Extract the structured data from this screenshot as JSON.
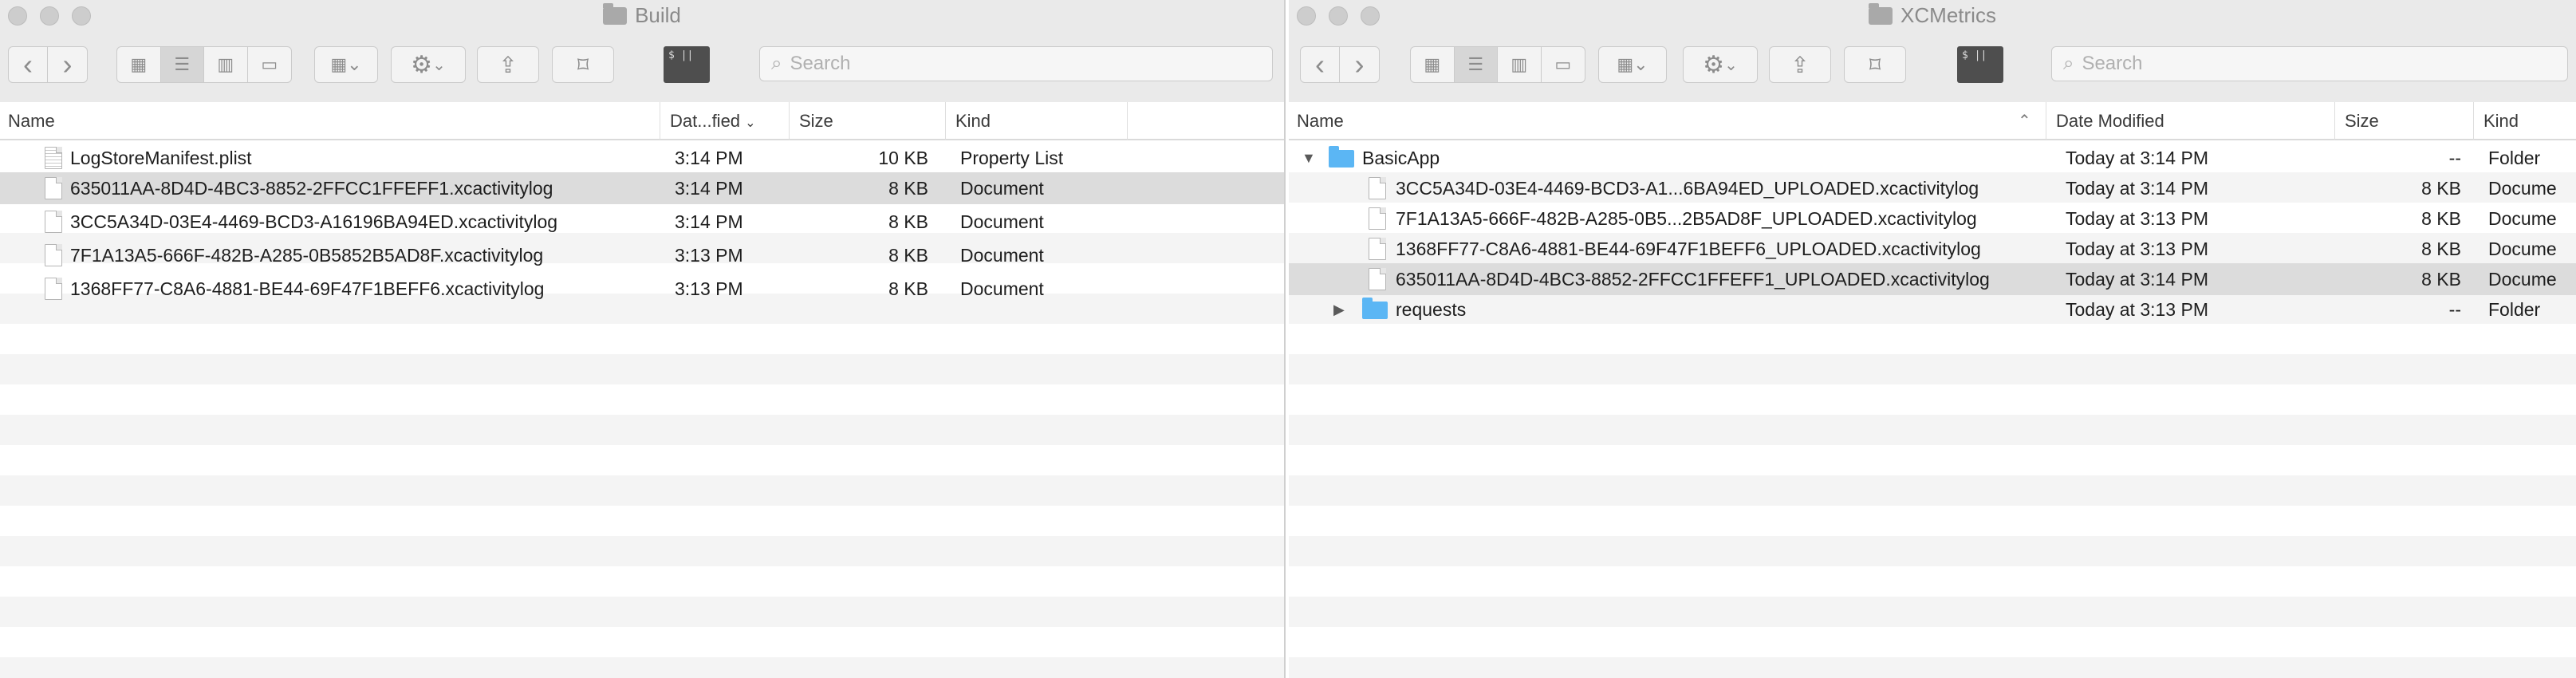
{
  "left_window": {
    "title": "Build",
    "search_placeholder": "Search",
    "columns": {
      "name": "Name",
      "date": "Dat...fied",
      "size": "Size",
      "kind": "Kind"
    },
    "rows": [
      {
        "name": "LogStoreManifest.plist",
        "date": "3:14 PM",
        "size": "10 KB",
        "kind": "Property List"
      },
      {
        "name": "635011AA-8D4D-4BC3-8852-2FFCC1FFEFF1.xcactivitylog",
        "date": "3:14 PM",
        "size": "8 KB",
        "kind": "Document"
      },
      {
        "name": "3CC5A34D-03E4-4469-BCD3-A16196BA94ED.xcactivitylog",
        "date": "3:14 PM",
        "size": "8 KB",
        "kind": "Document"
      },
      {
        "name": "7F1A13A5-666F-482B-A285-0B5852B5AD8F.xcactivitylog",
        "date": "3:13 PM",
        "size": "8 KB",
        "kind": "Document"
      },
      {
        "name": "1368FF77-C8A6-4881-BE44-69F47F1BEFF6.xcactivitylog",
        "date": "3:13 PM",
        "size": "8 KB",
        "kind": "Document"
      }
    ]
  },
  "right_window": {
    "title": "XCMetrics",
    "search_placeholder": "Search",
    "columns": {
      "name": "Name",
      "date": "Date Modified",
      "size": "Size",
      "kind": "Kind"
    },
    "rows": [
      {
        "name": "BasicApp",
        "date": "Today at 3:14 PM",
        "size": "--",
        "kind": "Folder"
      },
      {
        "name": "3CC5A34D-03E4-4469-BCD3-A1...6BA94ED_UPLOADED.xcactivitylog",
        "date": "Today at 3:14 PM",
        "size": "8 KB",
        "kind": "Docume"
      },
      {
        "name": "7F1A13A5-666F-482B-A285-0B5...2B5AD8F_UPLOADED.xcactivitylog",
        "date": "Today at 3:13 PM",
        "size": "8 KB",
        "kind": "Docume"
      },
      {
        "name": "1368FF77-C8A6-4881-BE44-69F47F1BEFF6_UPLOADED.xcactivitylog",
        "date": "Today at 3:13 PM",
        "size": "8 KB",
        "kind": "Docume"
      },
      {
        "name": "635011AA-8D4D-4BC3-8852-2FFCC1FFEFF1_UPLOADED.xcactivitylog",
        "date": "Today at 3:14 PM",
        "size": "8 KB",
        "kind": "Docume"
      },
      {
        "name": "requests",
        "date": "Today at 3:13 PM",
        "size": "--",
        "kind": "Folder"
      }
    ]
  },
  "icons": {
    "terminal_label": "$ ||",
    "back": "‹",
    "forward": "›",
    "chevron": "⌄",
    "gear": "⚙",
    "share": "⇪",
    "tag": "⌑",
    "search": "⌕",
    "disclosure_open": "▼",
    "disclosure_closed": "▶",
    "sort": "⌃"
  }
}
